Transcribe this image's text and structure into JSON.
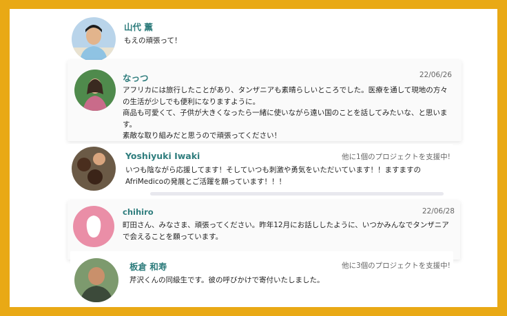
{
  "comments": [
    {
      "name": "山代 薫",
      "lines": [
        "もえの頑張って！"
      ],
      "avatar_colors": {
        "sky": "#b9d4ea",
        "skin": "#e2b48c",
        "shirt": "#8fc3e3",
        "hair": "#1d1d1d"
      }
    },
    {
      "name": "なっつ",
      "date": "22/06/26",
      "lines": [
        "アフリカには旅行したことがあり、タンザニアも素晴らしいところでした。医療を通して現地の方々",
        "の生活が少しでも便利になりますように。",
        "商品も可愛くて、子供が大きくなったら一緒に使いながら遠い国のことを話してみたいな、と思いま",
        "す。",
        "素敵な取り組みだと思うので頑張ってください！"
      ],
      "avatar_colors": {
        "bg": "#4f8a4c",
        "skin": "#e8b796",
        "hair": "#3a2a20",
        "cloth": "#c96b8a"
      }
    },
    {
      "name": "Yoshiyuki Iwaki",
      "support": "他に1個のプロジェクトを支援中!",
      "lines": [
        "いつも陰ながら応援してます！そしていつも刺激や勇気をいただいています！！ますますの",
        "AfriMedicoの発展とご活躍を願っています！！！"
      ],
      "avatar_colors": {
        "bg": "#6b5a46",
        "skin1": "#4a2e1e",
        "skin2": "#d9a57e",
        "skin3": "#3b2418"
      }
    },
    {
      "name": "chihiro",
      "date": "22/06/28",
      "lines": [
        "町田さん、みなさま、頑張ってください。昨年12月にお話ししたように、いつかみんなでタンザニア",
        "で会えることを願っています。"
      ],
      "avatar_colors": {
        "bg": "#ea8ea7",
        "inner": "#ffffff"
      }
    },
    {
      "name": "板倉 和寿",
      "support": "他に3個のプロジェクトを支援中!",
      "lines": [
        "芹沢くんの同級生です。彼の呼びかけで寄付いたしました。"
      ],
      "avatar_colors": {
        "bg": "#7d9a6e",
        "skin": "#c9906b",
        "cloth": "#3c4a3a"
      }
    }
  ]
}
